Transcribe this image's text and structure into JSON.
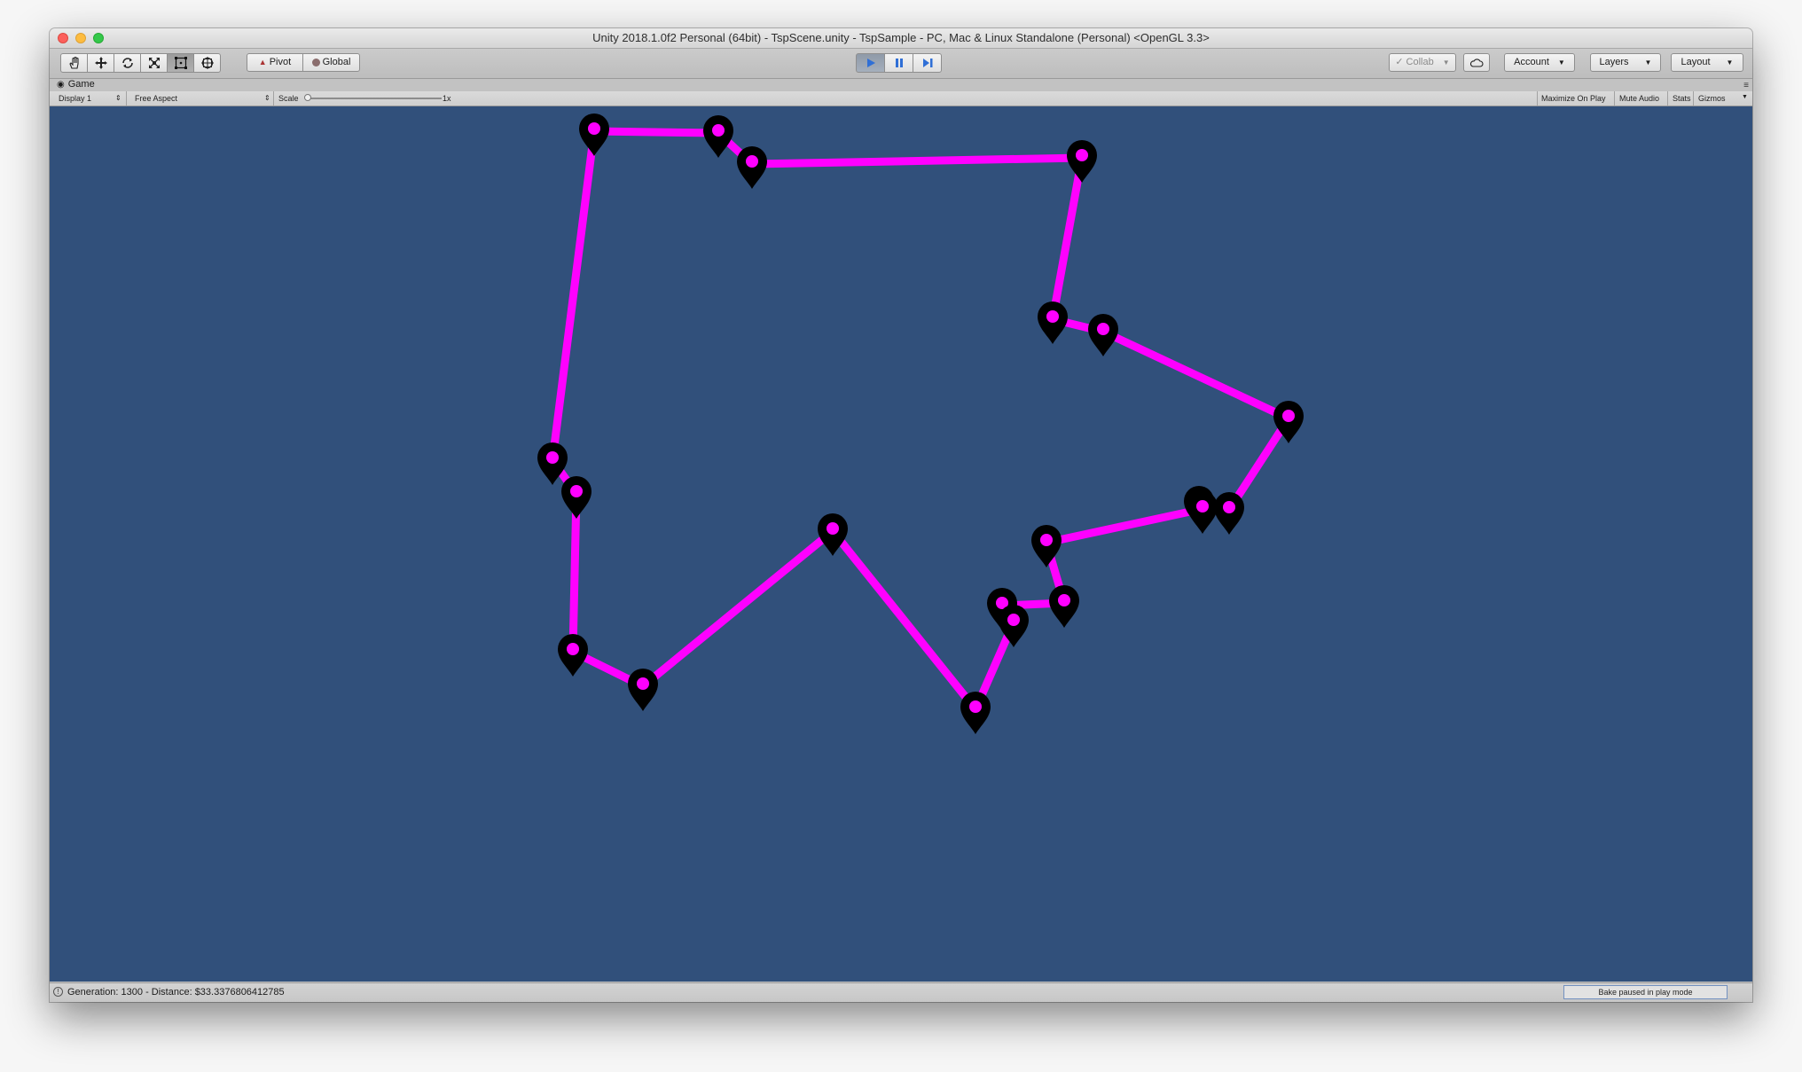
{
  "window": {
    "title": "Unity 2018.1.0f2 Personal (64bit) - TspScene.unity - TspSample - PC, Mac & Linux Standalone (Personal) <OpenGL 3.3>"
  },
  "toolbar": {
    "tools": [
      {
        "name": "hand-tool",
        "icon": "hand-icon"
      },
      {
        "name": "move-tool",
        "icon": "move-icon"
      },
      {
        "name": "rotate-tool",
        "icon": "rotate-icon"
      },
      {
        "name": "scale-tool",
        "icon": "scale-icon"
      },
      {
        "name": "rect-tool",
        "icon": "rect-icon",
        "active": true
      },
      {
        "name": "transform-tool",
        "icon": "transform-icon"
      }
    ],
    "pivot_label": "Pivot",
    "global_label": "Global",
    "collab_label": "Collab",
    "account_label": "Account",
    "layers_label": "Layers",
    "layout_label": "Layout",
    "play_active": true,
    "accent_color": "#2f6fd6"
  },
  "game_view": {
    "tab_label": "Game",
    "display_label": "Display 1",
    "aspect_label": "Free Aspect",
    "scale_label": "Scale",
    "scale_value": "1x",
    "maximize_label": "Maximize On Play",
    "mute_label": "Mute Audio",
    "stats_label": "Stats",
    "gizmos_label": "Gizmos",
    "background_color": "#31507b",
    "route_color": "#ff00ff",
    "marker_color": "#000000",
    "marker_icon": "map-pin-icon"
  },
  "status": {
    "message": "Generation: 1300 - Distance: $33.3376806412785",
    "bake_label": "Bake paused in play mode"
  }
}
